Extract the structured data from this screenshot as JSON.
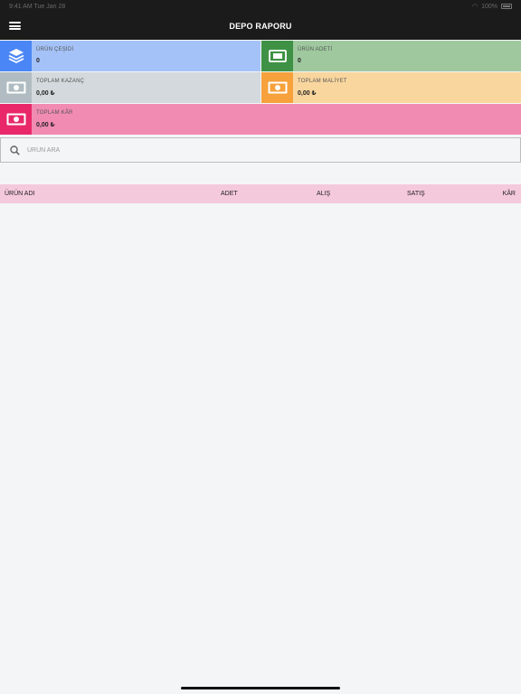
{
  "status": {
    "left": "9:41 AM   Tue Jan 28",
    "right": "100%"
  },
  "header": {
    "title": "DEPO RAPORU"
  },
  "cards": [
    {
      "label": "ÜRÜN ÇEŞİDİ",
      "value": "0",
      "icon": "layers-icon",
      "color": "#4a86f5",
      "bg": "#a4c2f7"
    },
    {
      "label": "ÜRÜN ADETİ",
      "value": "0",
      "icon": "ticket-icon",
      "color": "#3f9245",
      "bg": "#9fc89e"
    },
    {
      "label": "TOPLAM KAZANÇ",
      "value": "0,00 ₺",
      "icon": "cash-icon",
      "color": "#b0bcc1",
      "bg": "#d3d9dc"
    },
    {
      "label": "TOPLAM MALİYET",
      "value": "0,00 ₺",
      "icon": "cash-icon",
      "color": "#f6a13b",
      "bg": "#f9d69e"
    },
    {
      "label": "TOPLAM KÂR",
      "value": "0,00 ₺",
      "icon": "cash-icon",
      "color": "#e9286a",
      "bg": "#f18bb2"
    }
  ],
  "search": {
    "placeholder": "ÜRÜN ARA",
    "value": ""
  },
  "table": {
    "columns": [
      "ÜRÜN ADI",
      "ADET",
      "ALIŞ",
      "SATIŞ",
      "KÂR"
    ],
    "rows": []
  }
}
